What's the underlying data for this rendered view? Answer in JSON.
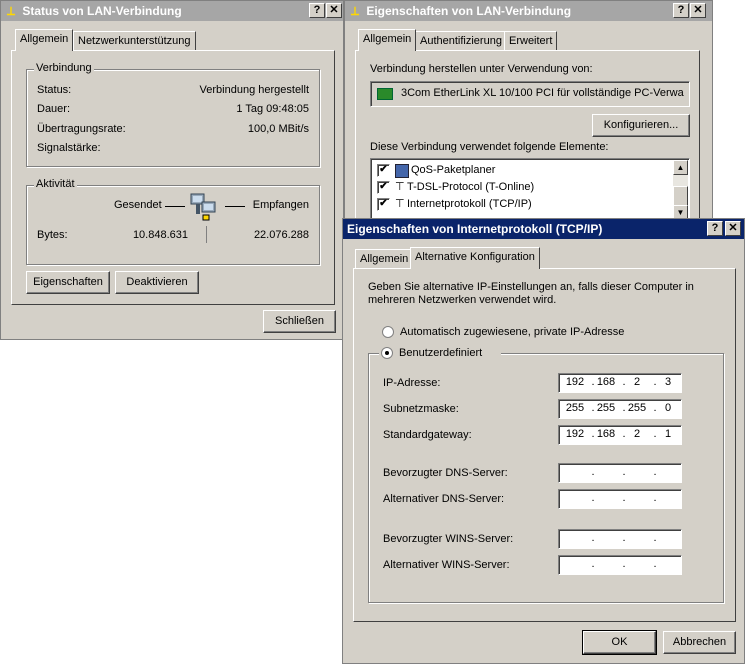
{
  "status_window": {
    "title": "Status von LAN-Verbindung",
    "help_button": "?",
    "close_button": "✕",
    "tabs": [
      "Allgemein",
      "Netzwerkunterstützung"
    ],
    "connection_group": {
      "title": "Verbindung",
      "rows": [
        {
          "label": "Status:",
          "value": "Verbindung hergestellt"
        },
        {
          "label": "Dauer:",
          "value": "1 Tag 09:48:05"
        },
        {
          "label": "Übertragungsrate:",
          "value": "100,0 MBit/s"
        },
        {
          "label": "Signalstärke:",
          "value": ""
        }
      ]
    },
    "activity_group": {
      "title": "Aktivität",
      "sent_label": "Gesendet",
      "received_label": "Empfangen",
      "bytes_label": "Bytes:",
      "sent_bytes": "10.848.631",
      "received_bytes": "22.076.288"
    },
    "properties_button": "Eigenschaften",
    "disable_button": "Deaktivieren",
    "close_dialog_button": "Schließen"
  },
  "props_window": {
    "title": "Eigenschaften von LAN-Verbindung",
    "help_button": "?",
    "close_button": "✕",
    "tabs": [
      "Allgemein",
      "Authentifizierung",
      "Erweitert"
    ],
    "connect_using_label": "Verbindung herstellen unter Verwendung von:",
    "adapter_name": "3Com EtherLink XL 10/100 PCI für vollständige PC-Verwa",
    "configure_button": "Konfigurieren...",
    "components_label": "Diese Verbindung verwendet folgende Elemente:",
    "components": [
      {
        "name": "QoS-Paketplaner",
        "checked": "✔"
      },
      {
        "name": "T-DSL-Protocol  (T-Online)",
        "checked": "✔"
      },
      {
        "name": "Internetprotokoll (TCP/IP)",
        "checked": "✔"
      }
    ]
  },
  "tcpip_window": {
    "title": "Eigenschaften von Internetprotokoll (TCP/IP)",
    "help_button": "?",
    "close_button": "✕",
    "tabs": [
      "Allgemein",
      "Alternative Konfiguration"
    ],
    "description": "Geben Sie alternative IP-Einstellungen an, falls dieser Computer in mehreren Netzwerken verwendet wird.",
    "auto_option": "Automatisch zugewiesene, private IP-Adresse",
    "custom_option": "Benutzerdefiniert",
    "fields": [
      {
        "label": "IP-Adresse:",
        "octets": [
          "192",
          "168",
          "2",
          "3"
        ]
      },
      {
        "label": "Subnetzmaske:",
        "octets": [
          "255",
          "255",
          "255",
          "0"
        ]
      },
      {
        "label": "Standardgateway:",
        "octets": [
          "192",
          "168",
          "2",
          "1"
        ]
      },
      {
        "label": "Bevorzugter DNS-Server:",
        "octets": [
          "",
          "",
          "",
          ""
        ]
      },
      {
        "label": "Alternativer DNS-Server:",
        "octets": [
          "",
          "",
          "",
          ""
        ]
      },
      {
        "label": "Bevorzugter WINS-Server:",
        "octets": [
          "",
          "",
          "",
          ""
        ]
      },
      {
        "label": "Alternativer WINS-Server:",
        "octets": [
          "",
          "",
          "",
          ""
        ]
      }
    ],
    "ok_button": "OK",
    "cancel_button": "Abbrechen"
  },
  "colors": {
    "dialog_face": "#d4d0c8",
    "active_titlebar": "#0a246a",
    "inactive_titlebar": "#a6a6a6"
  }
}
